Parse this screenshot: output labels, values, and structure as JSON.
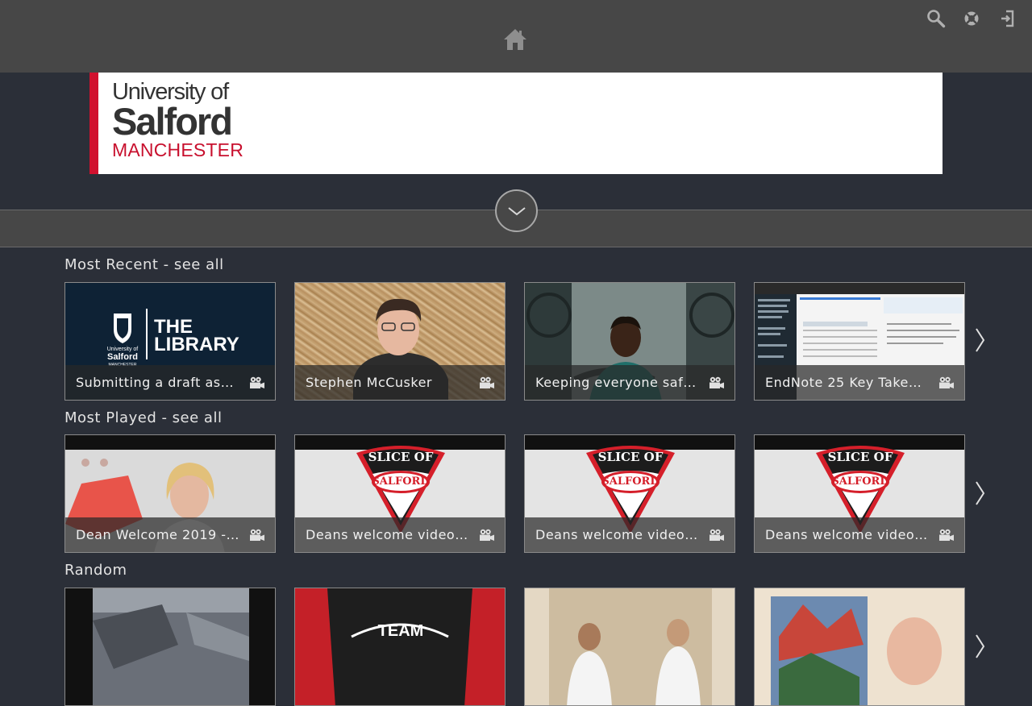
{
  "header": {
    "home_icon": "home-icon",
    "icons": [
      "search-icon",
      "help-icon",
      "login-icon"
    ]
  },
  "banner": {
    "logo_line1": "University of",
    "logo_line2": "Salford",
    "logo_line3": "MANCHESTER",
    "accent_color": "#d1122f"
  },
  "sections": {
    "most_recent": {
      "title": "Most Recent - see all",
      "items": [
        {
          "title": "Submitting a draft asse...",
          "thumb_text_1": "THE",
          "thumb_text_2": "LIBRARY",
          "thumb_text_3": "University of",
          "thumb_text_4": "Salford",
          "thumb_text_5": "MANCHESTER"
        },
        {
          "title": "Stephen McCusker"
        },
        {
          "title": "Keeping everyone safe ..."
        },
        {
          "title": "EndNote 25 Key Takea..."
        }
      ]
    },
    "most_played": {
      "title": "Most Played - see all",
      "items": [
        {
          "title": "Dean Welcome 2019 - ..."
        },
        {
          "title": "Deans welcome video -...",
          "badge_1": "SLICE OF",
          "badge_2": "SALFORD"
        },
        {
          "title": "Deans welcome video -...",
          "badge_1": "SLICE OF",
          "badge_2": "SALFORD"
        },
        {
          "title": "Deans welcome video -...",
          "badge_1": "SLICE OF",
          "badge_2": "SALFORD"
        }
      ]
    },
    "random": {
      "title": "Random",
      "items": [
        {
          "title": ""
        },
        {
          "title": "",
          "shirt_text": "TEAM"
        },
        {
          "title": ""
        },
        {
          "title": ""
        }
      ]
    }
  },
  "colors": {
    "page_bg": "#2b2f38",
    "header_bg": "#474747",
    "salford_red": "#c8102e",
    "library_navy": "#0e2235"
  }
}
